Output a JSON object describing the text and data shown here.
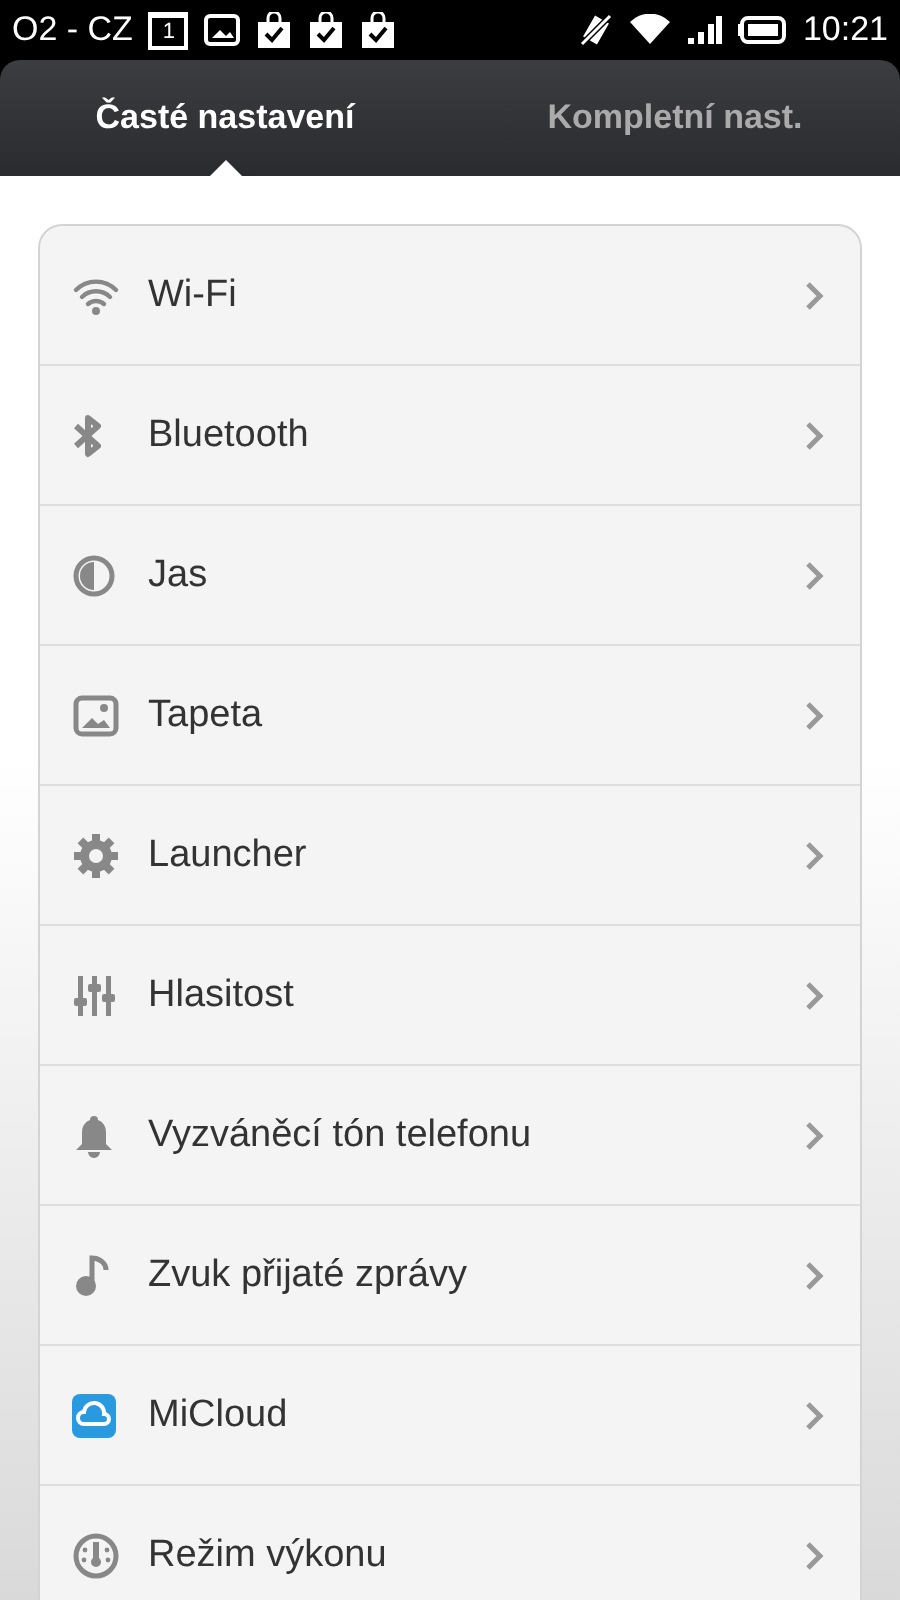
{
  "status_bar": {
    "carrier": "O2 - CZ",
    "calendar_day": "1",
    "time": "10:21"
  },
  "tabs": [
    {
      "label": "Časté nastavení",
      "selected": true
    },
    {
      "label": "Kompletní nast.",
      "selected": false
    }
  ],
  "items": [
    {
      "label": "Wi-Fi",
      "kind": "wifi"
    },
    {
      "label": "Bluetooth",
      "kind": "bluetooth"
    },
    {
      "label": "Jas",
      "kind": "brightness"
    },
    {
      "label": "Tapeta",
      "kind": "wallpaper"
    },
    {
      "label": "Launcher",
      "kind": "gear"
    },
    {
      "label": "Hlasitost",
      "kind": "sliders"
    },
    {
      "label": "Vyzváněcí tón telefonu",
      "kind": "bell"
    },
    {
      "label": "Zvuk přijaté zprávy",
      "kind": "note"
    },
    {
      "label": "MiCloud",
      "kind": "cloud"
    },
    {
      "label": "Režim výkonu",
      "kind": "gauge"
    }
  ]
}
